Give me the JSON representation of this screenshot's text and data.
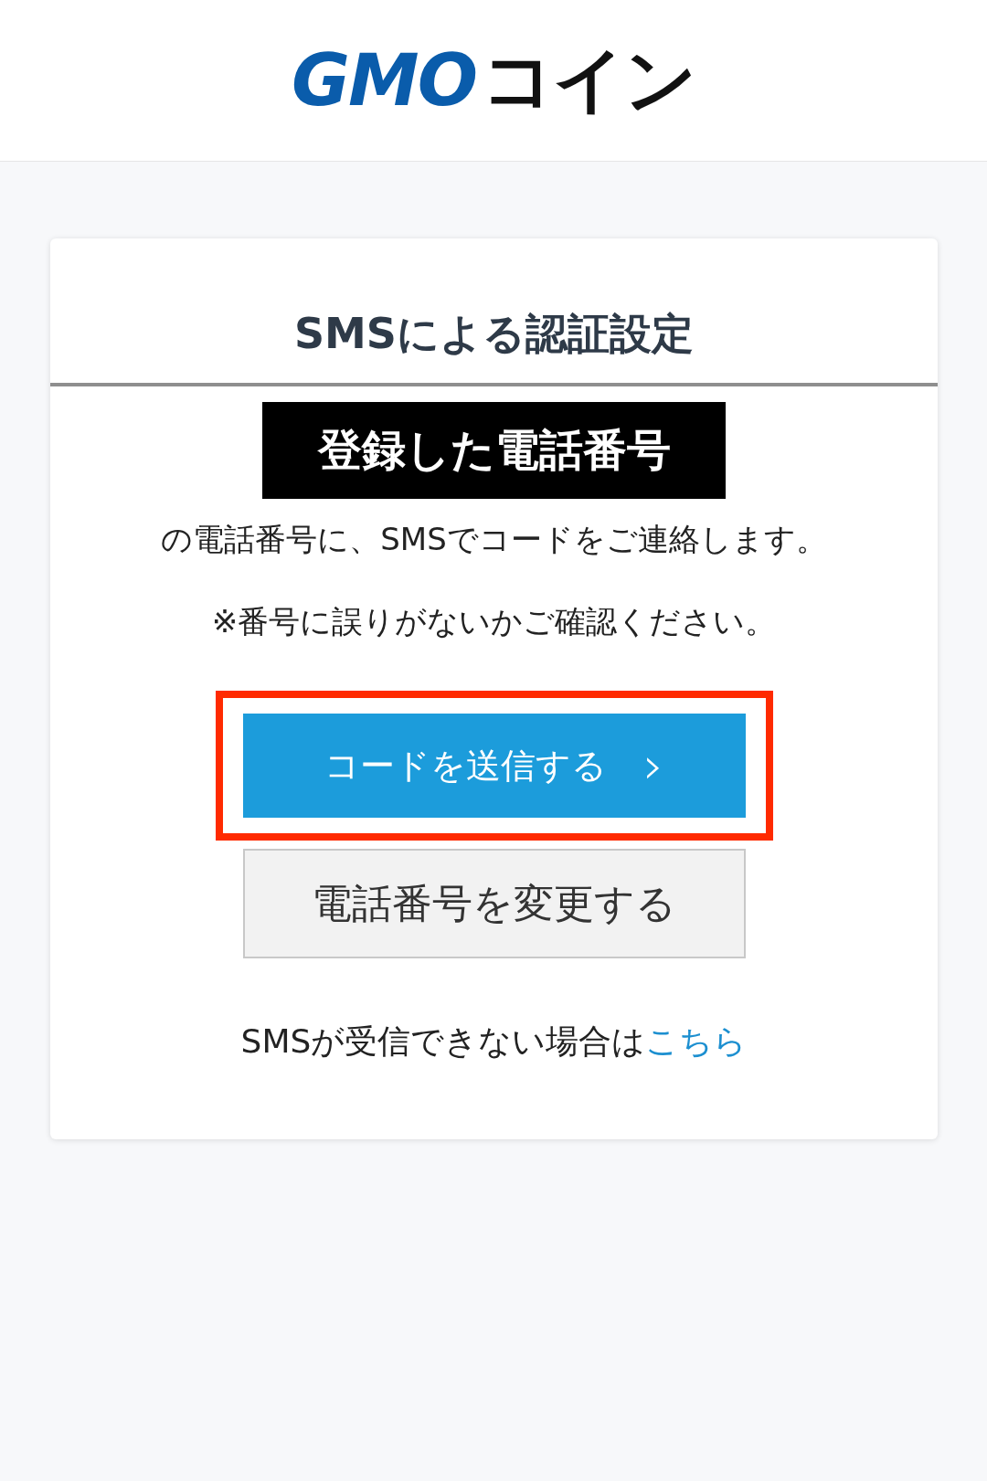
{
  "header": {
    "logo": {
      "brand": "GMO",
      "suffix": "コイン"
    }
  },
  "card": {
    "title": "SMSによる認証設定",
    "phone_label": "登録した電話番号",
    "message": "の電話番号に、SMSでコードをご連絡します。",
    "note": "※番号に誤りがないかご確認ください。",
    "buttons": [
      {
        "kind": "primary",
        "label": "コードを送信する",
        "icon": "›",
        "highlighted": true
      },
      {
        "kind": "secondary",
        "label": "電話番号を変更する",
        "highlighted": false
      }
    ],
    "help": {
      "text": "SMSが受信できない場合は",
      "link": "こちら"
    }
  }
}
